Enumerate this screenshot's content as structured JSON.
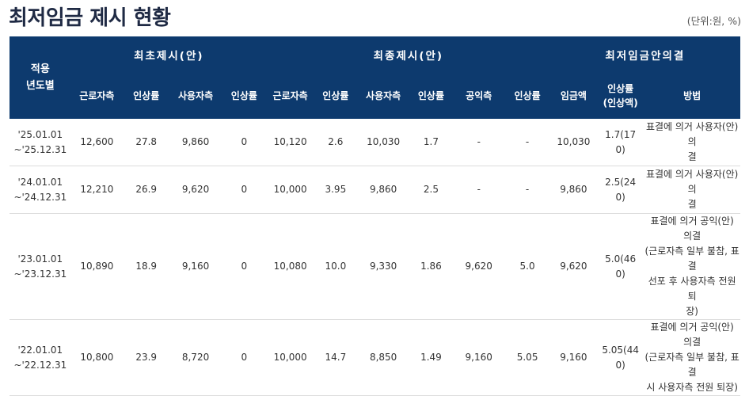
{
  "page": {
    "title": "최저임금 제시 현황",
    "unit": "(단위:원, %)"
  },
  "table": {
    "year_header": [
      "적용",
      "년도별"
    ],
    "groups": [
      "최초제시(안)",
      "최종제시(안)",
      "최저임금안의결"
    ],
    "sub_headers": {
      "first": [
        "근로자측",
        "인상률",
        "사용자측",
        "인상률"
      ],
      "final": [
        "근로자측",
        "인상률",
        "사용자측",
        "인상률",
        "공익측",
        "인상률"
      ],
      "decision_wage": "임금액",
      "decision_rate": [
        "인상률",
        "(인상액)"
      ],
      "decision_method": "방법"
    },
    "rows": [
      {
        "period": [
          "'25.01.01",
          "~'25.12.31"
        ],
        "first": [
          "12,600",
          "27.8",
          "9,860",
          "0"
        ],
        "final": [
          "10,120",
          "2.6",
          "10,030",
          "1.7",
          "-",
          "-"
        ],
        "wage": "10,030",
        "rate": [
          "1.7(17",
          "0)"
        ],
        "method": [
          "표결에 의거 사용자(안) 의",
          "결"
        ]
      },
      {
        "period": [
          "'24.01.01",
          "~'24.12.31"
        ],
        "first": [
          "12,210",
          "26.9",
          "9,620",
          "0"
        ],
        "final": [
          "10,000",
          "3.95",
          "9,860",
          "2.5",
          "-",
          "-"
        ],
        "wage": "9,860",
        "rate": [
          "2.5(24",
          "0)"
        ],
        "method": [
          "표결에 의거 사용자(안) 의",
          "결"
        ]
      },
      {
        "period": [
          "'23.01.01",
          "~'23.12.31"
        ],
        "first": [
          "10,890",
          "18.9",
          "9,160",
          "0"
        ],
        "final": [
          "10,080",
          "10.0",
          "9,330",
          "1.86",
          "9,620",
          "5.0"
        ],
        "wage": "9,620",
        "rate": [
          "5.0(46",
          "0)"
        ],
        "method": [
          "표결에 의거 공익(안) 의결",
          "(근로자측 일부 불참, 표결",
          "선포 후 사용자측 전원 퇴",
          "장)"
        ]
      },
      {
        "period": [
          "'22.01.01",
          "~'22.12.31"
        ],
        "first": [
          "10,800",
          "23.9",
          "8,720",
          "0"
        ],
        "final": [
          "10,000",
          "14.7",
          "8,850",
          "1.49",
          "9,160",
          "5.05"
        ],
        "wage": "9,160",
        "rate": [
          "5.05(44",
          "0)"
        ],
        "method": [
          "표결에 의거 공익(안) 의결",
          "(근로자측 일부 불참, 표결",
          "시 사용자측 전원 퇴장)"
        ]
      }
    ]
  }
}
